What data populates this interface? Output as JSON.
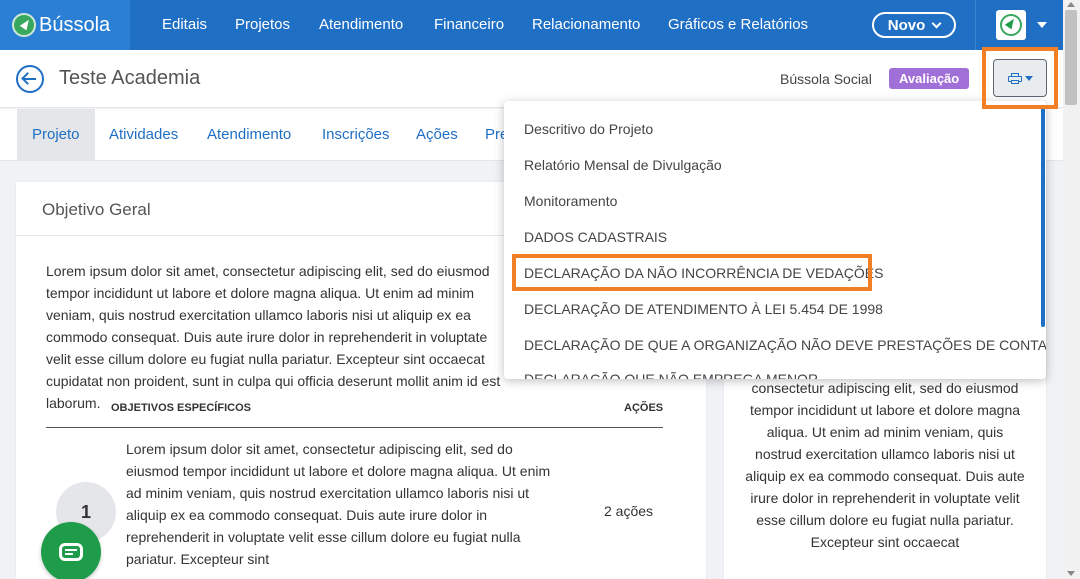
{
  "nav": {
    "logo_text": "Bússola",
    "items": [
      "Editais",
      "Projetos",
      "Atendimento",
      "Financeiro",
      "Relacionamento",
      "Gráficos e Relatórios"
    ],
    "novo_label": "Novo"
  },
  "header": {
    "title": "Teste Academia",
    "org_name": "Bússola Social",
    "status_badge": "Avaliação"
  },
  "tabs": [
    "Projeto",
    "Atividades",
    "Atendimento",
    "Inscrições",
    "Ações",
    "Pre"
  ],
  "main": {
    "card_title": "Objetivo Geral",
    "general_objective": "Lorem ipsum dolor sit amet, consectetur adipiscing elit, sed do eiusmod tempor incididunt ut labore et dolore magna aliqua. Ut enim ad minim veniam, quis nostrud exercitation ullamco laboris nisi ut aliquip ex ea commodo consequat. Duis aute irure dolor in reprehenderit in voluptate velit esse cillum dolore eu fugiat nulla pariatur. Excepteur sint occaecat cupidatat non proident, sunt in culpa qui officia deserunt mollit anim id est laborum.",
    "table_header_objectives": "OBJETIVOS ESPECÍFICOS",
    "table_header_actions": "AÇÕES",
    "rows": [
      {
        "number": "1",
        "text": "Lorem ipsum dolor sit amet, consectetur adipiscing elit, sed do eiusmod tempor incididunt ut labore et dolore magna aliqua. Ut enim ad minim veniam, quis nostrud exercitation ullamco laboris nisi ut aliquip ex ea commodo consequat. Duis aute irure dolor in reprehenderit in voluptate velit esse cillum dolore eu fugiat nulla pariatur. Excepteur sint",
        "actions": "2 ações"
      }
    ]
  },
  "right_panel": {
    "text": "consectetur adipiscing elit, sed do eiusmod tempor incididunt ut labore et dolore magna aliqua. Ut enim ad minim veniam, quis nostrud exercitation ullamco laboris nisi ut aliquip ex ea commodo consequat. Duis aute irure dolor in reprehenderit in voluptate velit esse cillum dolore eu fugiat nulla pariatur. Excepteur sint occaecat"
  },
  "print_menu": {
    "items": [
      "Descritivo do Projeto",
      "Relatório Mensal de Divulgação",
      "Monitoramento",
      "DADOS CADASTRAIS",
      "DECLARAÇÃO DA NÃO INCORRÊNCIA DE VEDAÇÕES",
      "DECLARAÇÃO DE ATENDIMENTO À LEI 5.454 DE 1998",
      "DECLARAÇÃO DE QUE A ORGANIZAÇÃO NÃO DEVE PRESTAÇÕES DE CONTAS",
      "DECLARAÇÃO QUE NÃO EMPREGA MENOR"
    ],
    "highlighted_index": 4
  },
  "icons": {
    "logo": "compass-logo-icon",
    "back": "back-arrow-icon",
    "print": "printer-icon",
    "chat": "chat-icon",
    "avatar": "user-avatar-icon"
  },
  "colors": {
    "nav_bg": "#1f6fc5",
    "accent": "#1f6fc5",
    "badge": "#a16fd8",
    "highlight": "#f07f26",
    "chat": "#1f9c4a"
  }
}
